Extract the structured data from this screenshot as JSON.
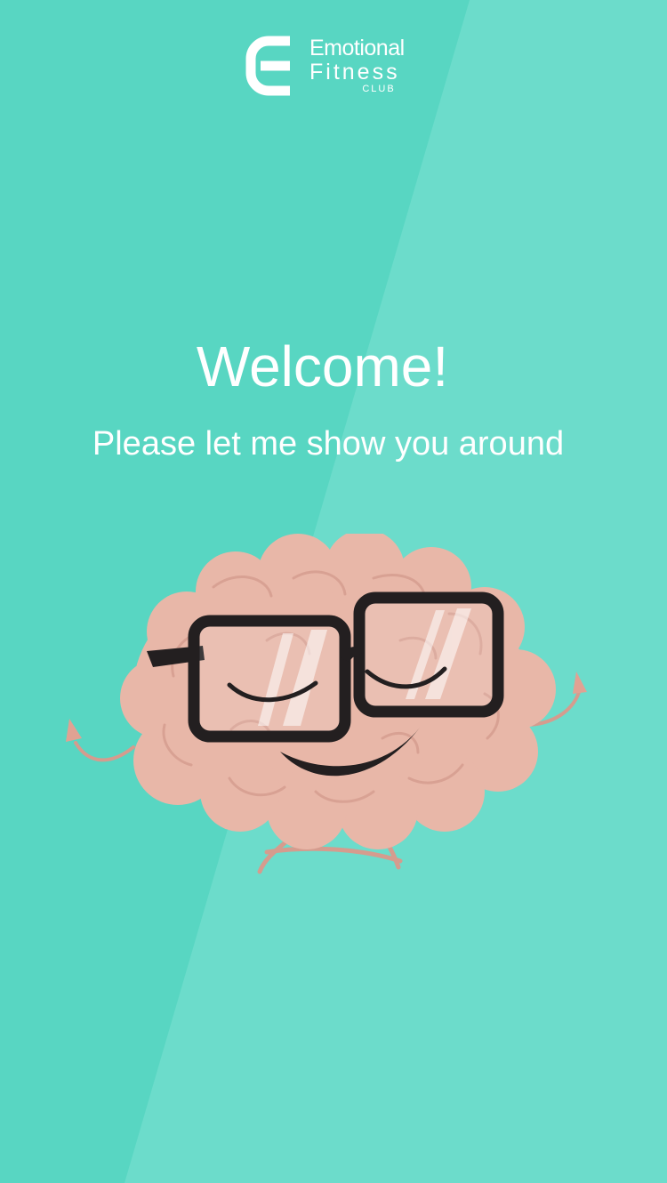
{
  "colors": {
    "background_light": "#6cdccb",
    "background_dark": "#58d6c2",
    "text": "#ffffff",
    "brain_fill": "#e8b7a8",
    "brain_line": "#d59c8e",
    "glasses": "#231f20"
  },
  "logo": {
    "line1": "Emotional",
    "line2": "Fitness",
    "line3": "CLUB",
    "icon": "e-monogram-icon"
  },
  "welcome": {
    "title": "Welcome!",
    "subtitle": "Please let me show you around"
  },
  "mascot": {
    "icon": "brain-with-glasses-icon"
  }
}
